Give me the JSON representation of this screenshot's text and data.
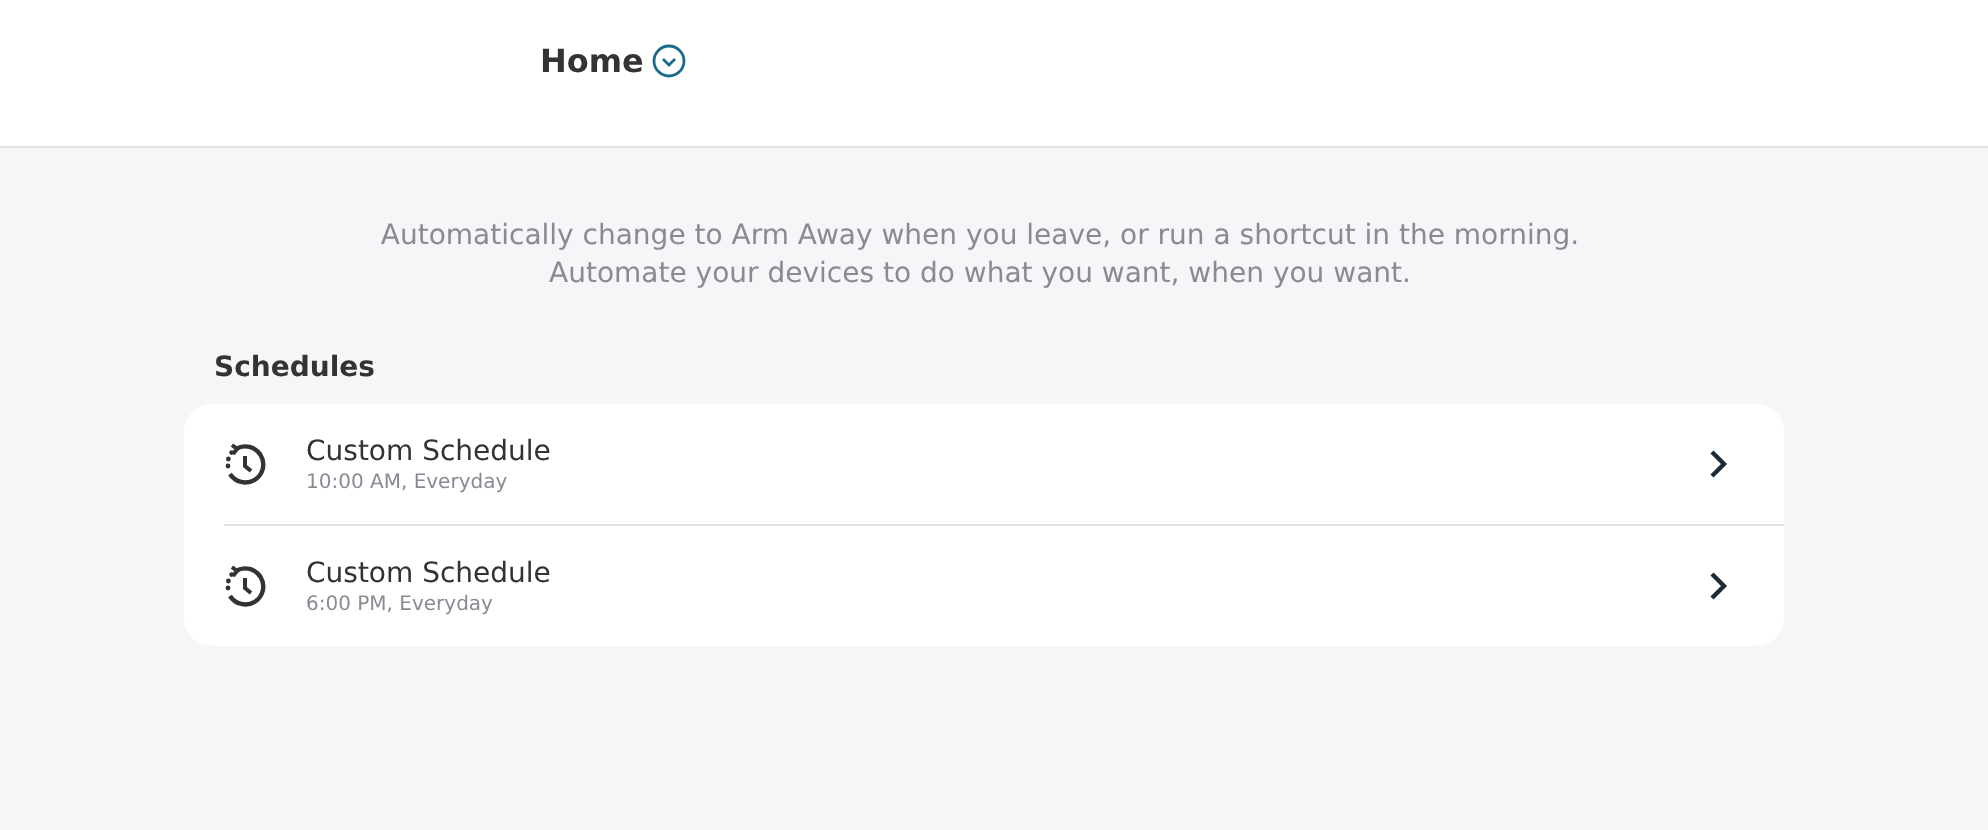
{
  "header": {
    "title": "Home"
  },
  "description": [
    "Automatically change to Arm Away when you leave, or run a shortcut in the morning.",
    "Automate your devices to do what you want, when you want."
  ],
  "schedules": {
    "heading": "Schedules",
    "items": [
      {
        "title": "Custom Schedule",
        "subtitle": "10:00 AM, Everyday"
      },
      {
        "title": "Custom Schedule",
        "subtitle": "6:00 PM, Everyday"
      }
    ]
  }
}
